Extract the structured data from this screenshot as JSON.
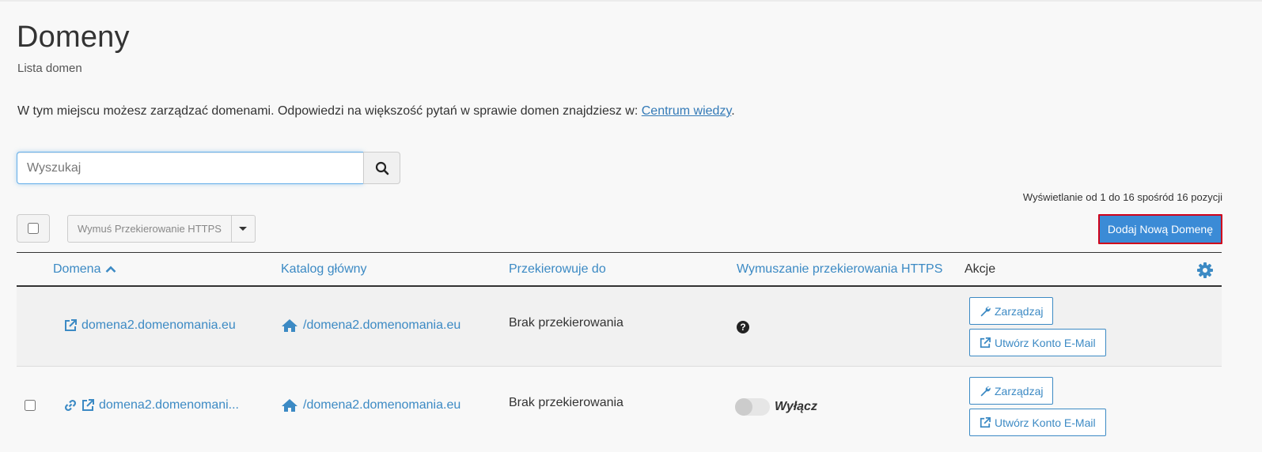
{
  "page": {
    "title": "Domeny",
    "subtitle": "Lista domen",
    "intro_text": "W tym miejscu możesz zarządzać domenami. Odpowiedzi na większość pytań w sprawie domen znajdziesz w: ",
    "intro_link": "Centrum wiedzy",
    "intro_end": "."
  },
  "search": {
    "placeholder": "Wyszukaj",
    "value": ""
  },
  "pagination": {
    "summary": "Wyświetlanie od 1 do 16 spośród 16 pozycji"
  },
  "toolbar": {
    "bulk_action_label": "Wymuś Przekierowanie HTTPS",
    "add_domain_label": "Dodaj Nową Domenę"
  },
  "table": {
    "columns": {
      "domain": "Domena",
      "root": "Katalog główny",
      "redirect": "Przekierowuje do",
      "https": "Wymuszanie przekierowania HTTPS",
      "actions": "Akcje"
    },
    "rows": [
      {
        "domain": "domena2.domenomania.eu",
        "root": "/domena2.domenomania.eu",
        "redirect": "Brak przekierowania",
        "manage": "Zarządzaj",
        "create_email": "Utwórz Konto E-Mail"
      },
      {
        "domain": "domena2.domenomani...",
        "root": "/domena2.domenomania.eu",
        "redirect": "Brak przekierowania",
        "https_state": "Wyłącz",
        "manage": "Zarządzaj",
        "create_email": "Utwórz Konto E-Mail"
      }
    ]
  },
  "colors": {
    "accent": "#3c8ac4",
    "primary_button": "#3b8bd6",
    "highlight_border": "#d0021b"
  }
}
